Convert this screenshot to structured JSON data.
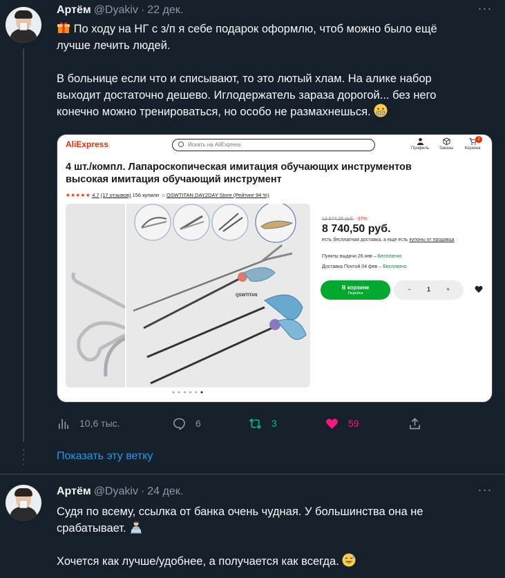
{
  "tweets": [
    {
      "author": "Артём",
      "handle": "@Dyakiv",
      "sep": "·",
      "date": "22 дек.",
      "lines": [
        "По ходу на НГ с з/п я себе подарок оформлю, чтоб можно было ещё",
        "лучше лечить людей.",
        "В больнице если что и списывают, то это лютый хлам. На алике набор",
        "выходит достаточно дешево. Иглодержатель зараза дорогой... без него",
        "конечно можно тренироваться, но особо не размахнешься."
      ],
      "stats": {
        "views": "10,6 тыс.",
        "replies": "6",
        "retweets": "3",
        "likes": "59"
      }
    },
    {
      "author": "Артём",
      "handle": "@Dyakiv",
      "sep": "·",
      "date": "24 дек.",
      "lines": [
        "Судя по всему, ссылка от банка очень чудная. У большинства она не",
        "срабатывает.",
        "Хочется как лучше/удобнее, а получается как всегда."
      ]
    }
  ],
  "more_glyph": "···",
  "show_thread": "Показать эту ветку",
  "aliexpress": {
    "logo": "AliExpress",
    "search_placeholder": "Искать на AliExpress",
    "nav": {
      "profile": "Профиль",
      "orders": "Заказы",
      "cart": "Корзина",
      "cart_count": "2"
    },
    "title_lines": [
      "4 шт./компл. Лапароскопическая имитация обучающих инструментов",
      "высокая имитация обучающий инструмент"
    ],
    "stars": "★★★★★",
    "rating": "4.7",
    "reviews": "(17 отзывов)",
    "bought": "156 купили",
    "store": "QSWTITAN DAY2DAY Store (Рейтинг 94 %)",
    "brand_label": "QSWTITAN",
    "old_price": "13 874,25 руб.",
    "discount": "-37%",
    "price": "8 740,50 руб.",
    "shipping": "есть бесплатная доставка, а еще есть",
    "shipping_link": "купоны от продавца",
    "pickup": "Пункты выдачи 26 янв –",
    "post": "Доставка Почтой 04 фев –",
    "free": "Бесплатно",
    "cart_button": "В корзине",
    "cart_sub": "Перейти",
    "qty_minus": "−",
    "qty_value": "1",
    "qty_plus": "+"
  },
  "colors": {
    "bg": "#15202b",
    "text": "#f7f9f9",
    "muted": "#8b98a5",
    "link": "#1d9bf0",
    "retweet": "#00ba7c",
    "like": "#f91880"
  }
}
